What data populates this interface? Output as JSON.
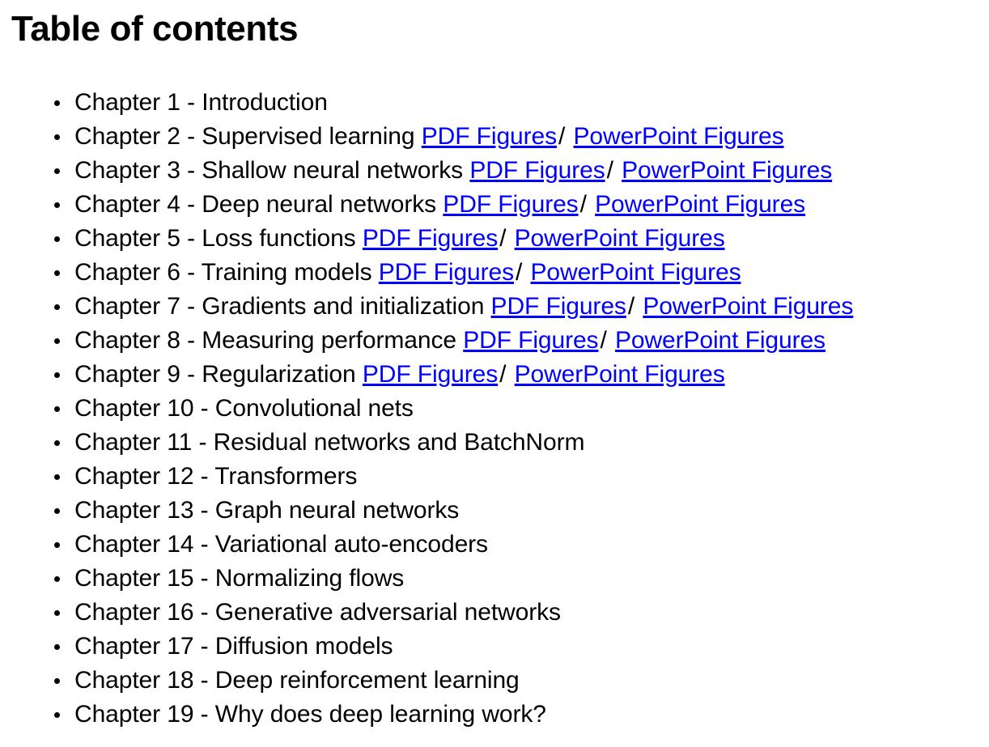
{
  "page": {
    "title": "Table of contents",
    "background_color": "#ffffff",
    "text_color": "#000000",
    "link_color": "#0000ff",
    "link_separator": "/",
    "bullet_glyph": "•"
  },
  "toc": {
    "items": [
      {
        "label": "Chapter 1 - Introduction",
        "links": []
      },
      {
        "label": "Chapter 2 - Supervised learning",
        "links": [
          "PDF Figures",
          "PowerPoint Figures"
        ]
      },
      {
        "label": "Chapter 3 - Shallow neural networks",
        "links": [
          "PDF Figures",
          "PowerPoint Figures"
        ]
      },
      {
        "label": "Chapter 4 - Deep neural networks",
        "links": [
          "PDF Figures",
          "PowerPoint Figures"
        ]
      },
      {
        "label": "Chapter 5 - Loss functions",
        "links": [
          "PDF Figures",
          "PowerPoint Figures"
        ]
      },
      {
        "label": "Chapter 6 - Training models",
        "links": [
          "PDF Figures",
          "PowerPoint Figures"
        ]
      },
      {
        "label": "Chapter 7 - Gradients and initialization",
        "links": [
          "PDF Figures",
          "PowerPoint Figures"
        ]
      },
      {
        "label": "Chapter 8 - Measuring performance",
        "links": [
          "PDF Figures",
          "PowerPoint Figures"
        ]
      },
      {
        "label": "Chapter 9 - Regularization",
        "links": [
          "PDF Figures",
          "PowerPoint Figures"
        ]
      },
      {
        "label": "Chapter 10 - Convolutional nets",
        "links": []
      },
      {
        "label": "Chapter 11 - Residual networks and BatchNorm",
        "links": []
      },
      {
        "label": "Chapter 12 - Transformers",
        "links": []
      },
      {
        "label": "Chapter 13 - Graph neural networks",
        "links": []
      },
      {
        "label": "Chapter 14 - Variational auto-encoders",
        "links": []
      },
      {
        "label": "Chapter 15 - Normalizing flows",
        "links": []
      },
      {
        "label": "Chapter 16 - Generative adversarial networks",
        "links": []
      },
      {
        "label": "Chapter 17 - Diffusion models",
        "links": []
      },
      {
        "label": "Chapter 18 - Deep reinforcement learning",
        "links": []
      },
      {
        "label": "Chapter 19 - Why does deep learning work?",
        "links": []
      }
    ]
  }
}
